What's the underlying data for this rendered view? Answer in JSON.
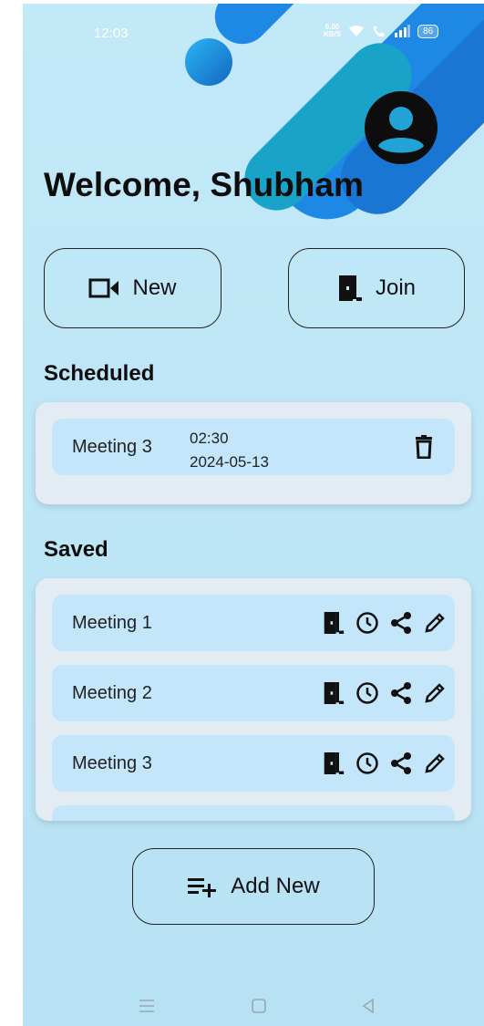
{
  "status_bar": {
    "time": "12:03",
    "net_speed_value": "0.00",
    "net_speed_unit": "KB/S",
    "battery": "86"
  },
  "header": {
    "welcome": "Welcome, Shubham",
    "avatar_icon": "account-circle-icon"
  },
  "actions": {
    "new_label": "New",
    "new_icon": "videocam-icon",
    "join_label": "Join",
    "join_icon": "door-icon"
  },
  "scheduled": {
    "title": "Scheduled",
    "items": [
      {
        "name": "Meeting 3",
        "time": "02:30",
        "date": "2024-05-13",
        "icon": "delete-icon"
      }
    ]
  },
  "saved": {
    "title": "Saved",
    "items": [
      {
        "name": "Meeting 1"
      },
      {
        "name": "Meeting 2"
      },
      {
        "name": "Meeting 3"
      }
    ],
    "row_icons": [
      "door-icon",
      "clock-icon",
      "share-icon",
      "edit-icon"
    ]
  },
  "add_new": {
    "label": "Add New",
    "icon": "playlist-add-icon"
  },
  "nav": {
    "icons": [
      "menu-icon",
      "home-icon",
      "back-icon"
    ]
  },
  "colors": {
    "background": "#bfe6f6",
    "card": "#e4ecf3",
    "row": "#c4e6fb",
    "accent_blue": "#1e88e5",
    "accent_cyan": "#00bcd4"
  }
}
